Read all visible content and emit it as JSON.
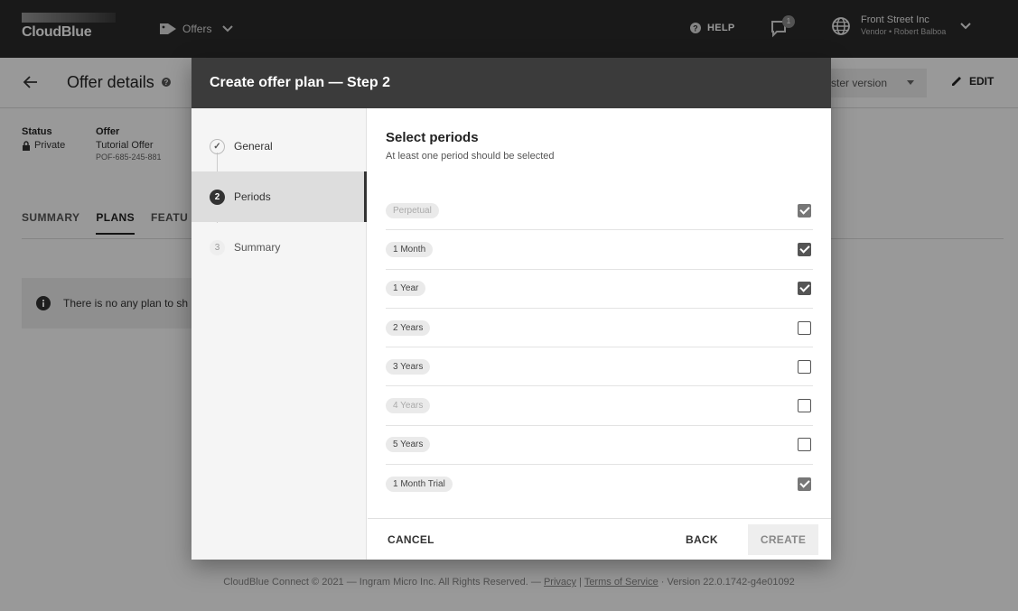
{
  "appbar": {
    "logo_text": "CloudBlue",
    "module_label": "Offers",
    "help_label": "HELP",
    "notification_count": "1",
    "account_name": "Front Street Inc",
    "account_sub": "Vendor • Robert Balboa"
  },
  "page": {
    "title": "Offer details",
    "version_select": "ster version",
    "edit_label": "EDIT",
    "status_key": "Status",
    "status_value": "Private",
    "offer_key": "Offer",
    "offer_name": "Tutorial Offer",
    "offer_id": "POF-685-245-881",
    "tabs": [
      "SUMMARY",
      "PLANS",
      "FEATU"
    ],
    "info_text": "There is no any plan to sh"
  },
  "footer": {
    "prefix": "CloudBlue Connect © 2021 — Ingram Micro Inc. All Rights Reserved. — ",
    "privacy": "Privacy",
    "sep": " | ",
    "terms": "Terms of Service",
    "version": " · Version 22.0.1742-g4e01092"
  },
  "dialog": {
    "title": "Create offer plan — Step 2",
    "steps": [
      {
        "num": "✓",
        "label": "General",
        "state": "done"
      },
      {
        "num": "2",
        "label": "Periods",
        "state": "active"
      },
      {
        "num": "3",
        "label": "Summary",
        "state": "pending"
      }
    ],
    "section_title": "Select periods",
    "section_subtitle": "At least one period should be selected",
    "periods": [
      {
        "label": "Perpetual",
        "checked": true,
        "disabled": true
      },
      {
        "label": "1 Month",
        "checked": true,
        "disabled": false
      },
      {
        "label": "1 Year",
        "checked": true,
        "disabled": false
      },
      {
        "label": "2 Years",
        "checked": false,
        "disabled": false
      },
      {
        "label": "3 Years",
        "checked": false,
        "disabled": false
      },
      {
        "label": "4 Years",
        "checked": false,
        "disabled": true
      },
      {
        "label": "5 Years",
        "checked": false,
        "disabled": false
      },
      {
        "label": "1 Month Trial",
        "checked": true,
        "disabled": true
      }
    ],
    "cancel_label": "CANCEL",
    "back_label": "BACK",
    "create_label": "CREATE"
  }
}
